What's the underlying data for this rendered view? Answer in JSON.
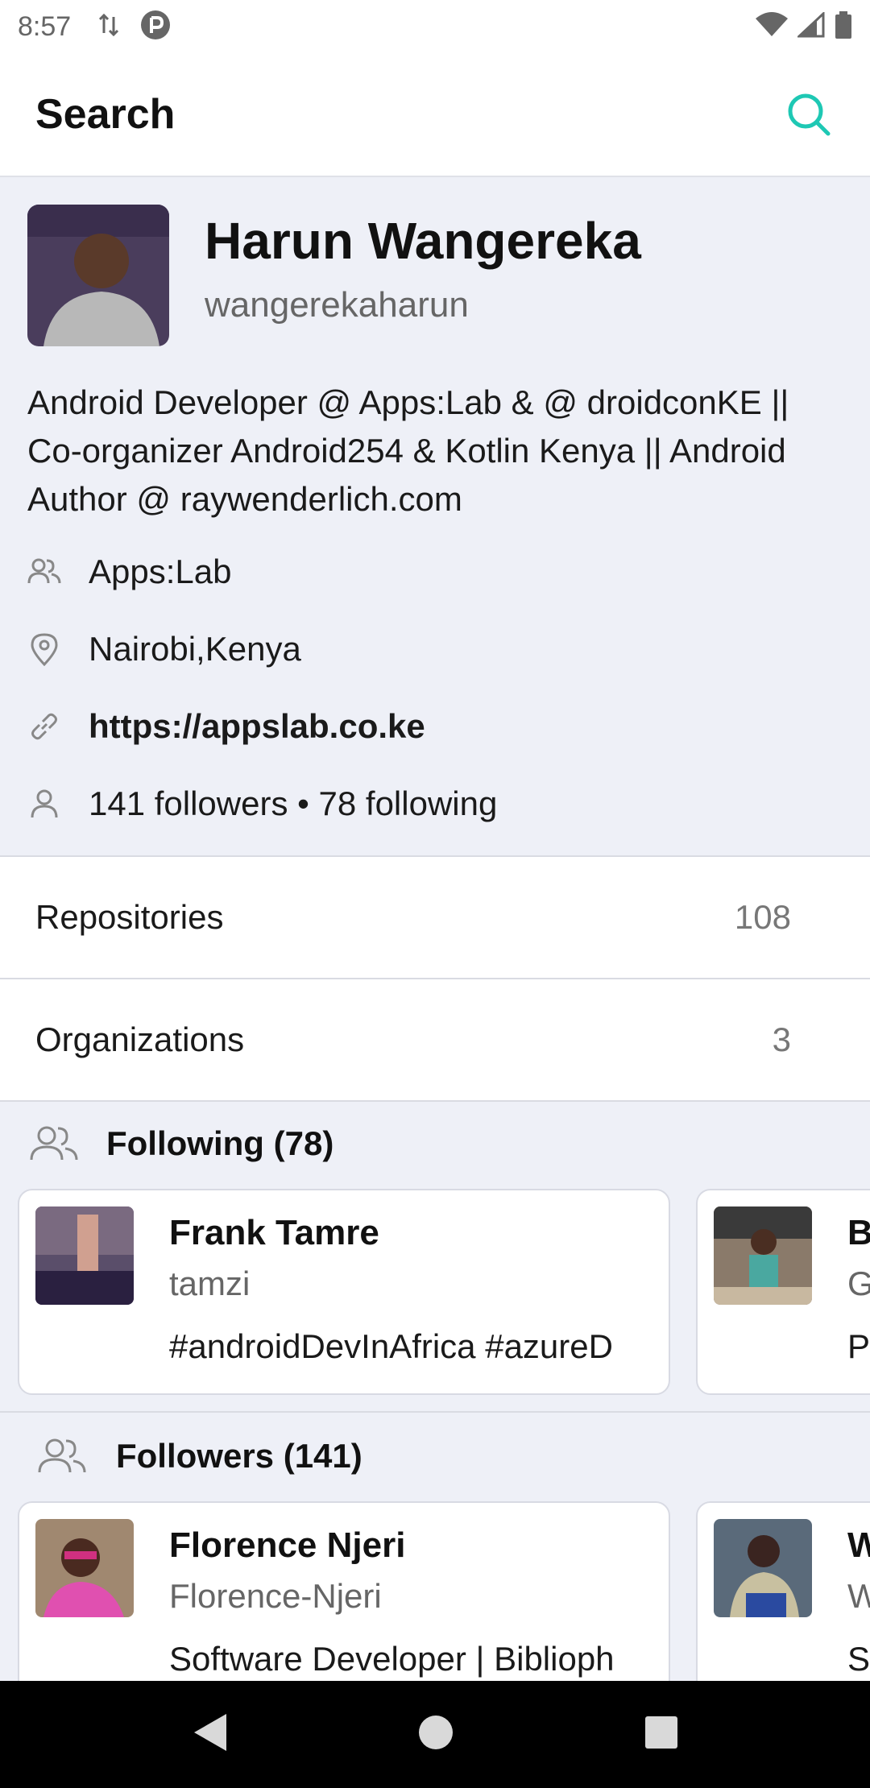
{
  "status_bar": {
    "time": "8:57"
  },
  "app_bar": {
    "title": "Search"
  },
  "profile": {
    "name": "Harun Wangereka",
    "login": "wangerekaharun",
    "bio": "Android Developer @ Apps:Lab & @ droidconKE || Co-organizer Android254 & Kotlin Kenya || Android Author @ raywenderlich.com",
    "company": "Apps:Lab",
    "location": "Nairobi,Kenya",
    "website": "https://appslab.co.ke",
    "followers_following": "141 followers • 78 following"
  },
  "menu": {
    "repositories": {
      "label": "Repositories",
      "count": "108"
    },
    "organizations": {
      "label": "Organizations",
      "count": "3"
    }
  },
  "following": {
    "title": "Following (78)",
    "cards": [
      {
        "name": "Frank Tamre",
        "login": "tamzi",
        "bio": "#androidDevInAfrica #azureD"
      },
      {
        "name": "B",
        "login": "G",
        "bio": "P"
      }
    ]
  },
  "followers": {
    "title": "Followers (141)",
    "cards": [
      {
        "name": "Florence Njeri",
        "login": "Florence-Njeri",
        "bio": "Software Developer | Biblioph"
      },
      {
        "name": "W",
        "login": "W",
        "bio": "S"
      }
    ]
  },
  "colors": {
    "accent": "#1ec8b4",
    "background": "#eef0f7",
    "card": "#ffffff"
  }
}
